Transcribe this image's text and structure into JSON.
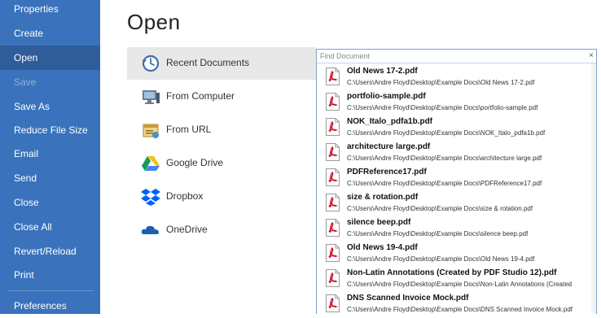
{
  "sidebar": {
    "items": [
      {
        "label": "Properties",
        "state": "normal"
      },
      {
        "label": "Create",
        "state": "normal"
      },
      {
        "label": "Open",
        "state": "active"
      },
      {
        "label": "Save",
        "state": "disabled"
      },
      {
        "label": "Save As",
        "state": "normal"
      },
      {
        "label": "Reduce File Size",
        "state": "normal"
      },
      {
        "label": "Email",
        "state": "normal"
      },
      {
        "label": "Send",
        "state": "normal"
      },
      {
        "label": "Close",
        "state": "normal"
      },
      {
        "label": "Close All",
        "state": "normal"
      },
      {
        "label": "Revert/Reload",
        "state": "normal"
      },
      {
        "label": "Print",
        "state": "normal"
      },
      {
        "label": "Preferences",
        "state": "normal"
      }
    ]
  },
  "main": {
    "title": "Open",
    "sources": [
      {
        "label": "Recent Documents",
        "icon": "recent-documents-icon",
        "active": true
      },
      {
        "label": "From Computer",
        "icon": "computer-icon",
        "active": false
      },
      {
        "label": "From URL",
        "icon": "url-icon",
        "active": false
      },
      {
        "label": "Google Drive",
        "icon": "google-drive-icon",
        "active": false
      },
      {
        "label": "Dropbox",
        "icon": "dropbox-icon",
        "active": false
      },
      {
        "label": "OneDrive",
        "icon": "onedrive-icon",
        "active": false
      }
    ]
  },
  "recent": {
    "search_placeholder": "Find Document",
    "clear_label": "×",
    "documents": [
      {
        "name": "Old News 17-2.pdf",
        "path": "C:\\Users\\Andre Floyd\\Desktop\\Example Docs\\Old News 17-2.pdf"
      },
      {
        "name": "portfolio-sample.pdf",
        "path": "C:\\Users\\Andre Floyd\\Desktop\\Example Docs\\portfolio-sample.pdf"
      },
      {
        "name": "NOK_Italo_pdfa1b.pdf",
        "path": "C:\\Users\\Andre Floyd\\Desktop\\Example Docs\\NOK_Italo_pdfa1b.pdf"
      },
      {
        "name": "architecture large.pdf",
        "path": "C:\\Users\\Andre Floyd\\Desktop\\Example Docs\\architecture large.pdf"
      },
      {
        "name": "PDFReference17.pdf",
        "path": "C:\\Users\\Andre Floyd\\Desktop\\Example Docs\\PDFReference17.pdf"
      },
      {
        "name": "size & rotation.pdf",
        "path": "C:\\Users\\Andre Floyd\\Desktop\\Example Docs\\size & rotation.pdf"
      },
      {
        "name": "silence beep.pdf",
        "path": "C:\\Users\\Andre Floyd\\Desktop\\Example Docs\\silence beep.pdf"
      },
      {
        "name": "Old News 19-4.pdf",
        "path": "C:\\Users\\Andre Floyd\\Desktop\\Example Docs\\Old News 19-4.pdf"
      },
      {
        "name": "Non-Latin Annotations (Created by PDF Studio 12).pdf",
        "path": "C:\\Users\\Andre Floyd\\Desktop\\Example Docs\\Non-Latin Annotations (Created"
      },
      {
        "name": "DNS Scanned Invoice Mock.pdf",
        "path": "C:\\Users\\Andre Floyd\\Desktop\\Example Docs\\DNS Scanned Invoice Mock.pdf"
      }
    ]
  },
  "colors": {
    "sidebar": "#3a73bb",
    "sidebar_active": "#2f5d9a",
    "pdf_red": "#c8102e"
  }
}
